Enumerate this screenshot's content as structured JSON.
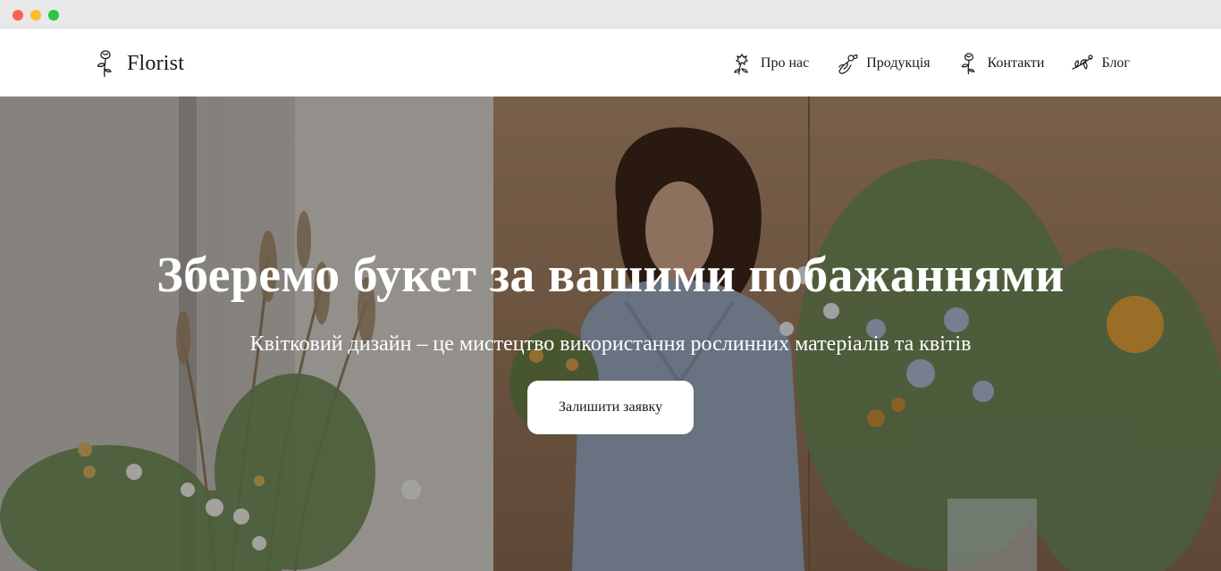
{
  "header": {
    "logo_text": "Florist",
    "logo_icon": "rose-icon",
    "nav": [
      {
        "label": "Про нас",
        "icon": "flower-bud-icon"
      },
      {
        "label": "Продукція",
        "icon": "bouquet-icon"
      },
      {
        "label": "Контакти",
        "icon": "rose-icon"
      },
      {
        "label": "Блог",
        "icon": "branch-icon"
      }
    ]
  },
  "hero": {
    "title": "Зберемо букет за вашими побажаннями",
    "subtitle": "Квітковий дизайн – це мистецтво використання рослинних матеріалів та квітів",
    "cta_label": "Залишити заявку"
  },
  "colors": {
    "header_bg": "#ffffff",
    "hero_overlay": "#000000",
    "button_bg": "#ffffff",
    "text_dark": "#1a1a1a",
    "text_light": "#ffffff"
  }
}
